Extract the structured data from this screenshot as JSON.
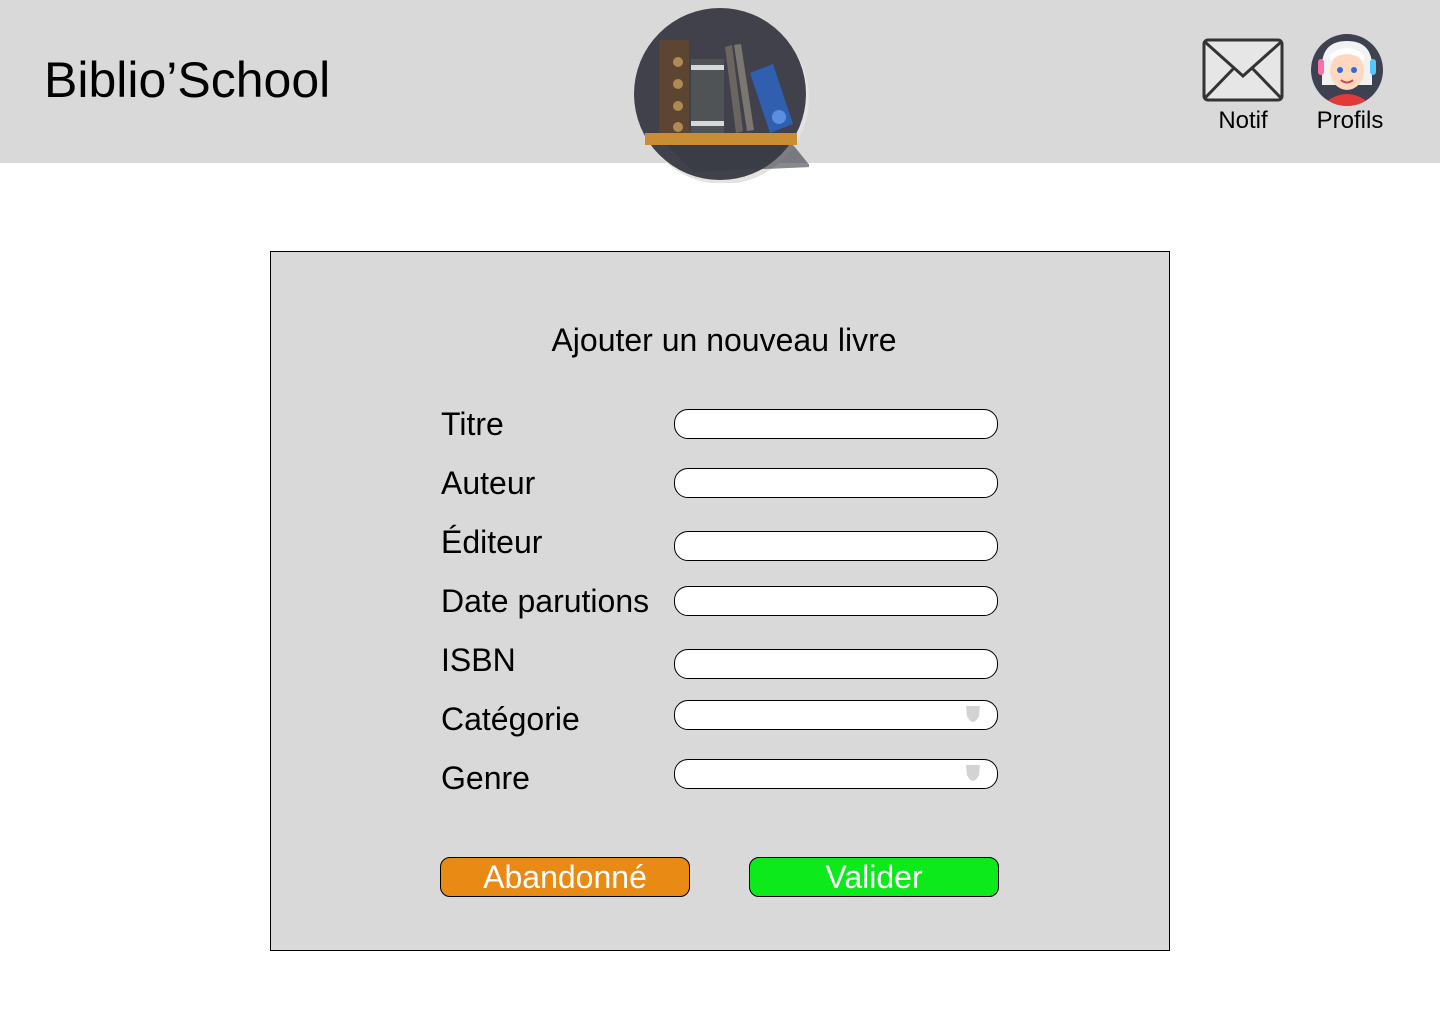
{
  "header": {
    "app_title": "Biblio’School",
    "notif_label": "Notif",
    "profile_label": "Profils"
  },
  "icons": {
    "logo": "bookshelf-logo",
    "notif": "envelope-icon",
    "profile": "avatar",
    "select_indicator": "chevron-down-icon"
  },
  "form": {
    "title": "Ajouter un nouveau livre",
    "fields": [
      {
        "label": "Titre",
        "value": ""
      },
      {
        "label": "Auteur",
        "value": ""
      },
      {
        "label": "Éditeur",
        "value": ""
      },
      {
        "label": "Date parutions",
        "value": ""
      },
      {
        "label": "ISBN",
        "value": ""
      },
      {
        "label": "Catégorie",
        "value": ""
      },
      {
        "label": "Genre",
        "value": ""
      }
    ],
    "cancel_label": "Abandonné",
    "submit_label": "Valider"
  },
  "colors": {
    "header_bg": "#d9d9d9",
    "panel_bg": "#d9d9d9",
    "cancel_button": "#e98a15",
    "submit_button": "#0cea1c"
  }
}
